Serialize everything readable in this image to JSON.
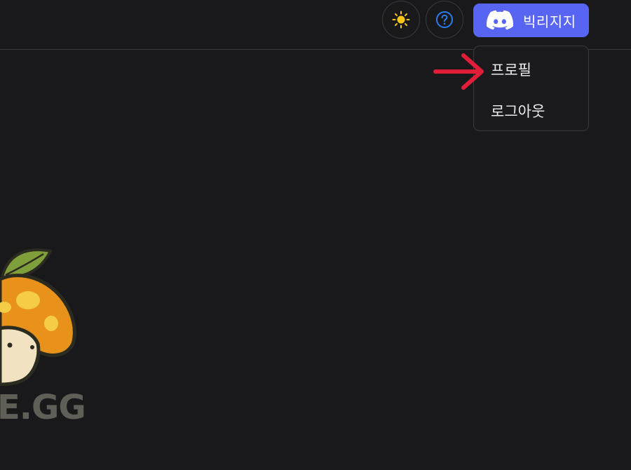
{
  "header": {
    "theme_toggle_icon": "sun-icon",
    "help_icon": "question-circle-icon",
    "discord_icon": "discord-icon",
    "user_name": "빅리지지",
    "colors": {
      "background": "#19191b",
      "discord": "#5865f2",
      "sun": "#f5c518",
      "help": "#2b7de9",
      "annotation_arrow": "#e01e37"
    }
  },
  "user_menu": {
    "items": [
      {
        "label": "프로필"
      },
      {
        "label": "로그아웃"
      }
    ]
  },
  "logo": {
    "text": "RE.GG",
    "mascot_icon": "mushroom-mascot"
  }
}
